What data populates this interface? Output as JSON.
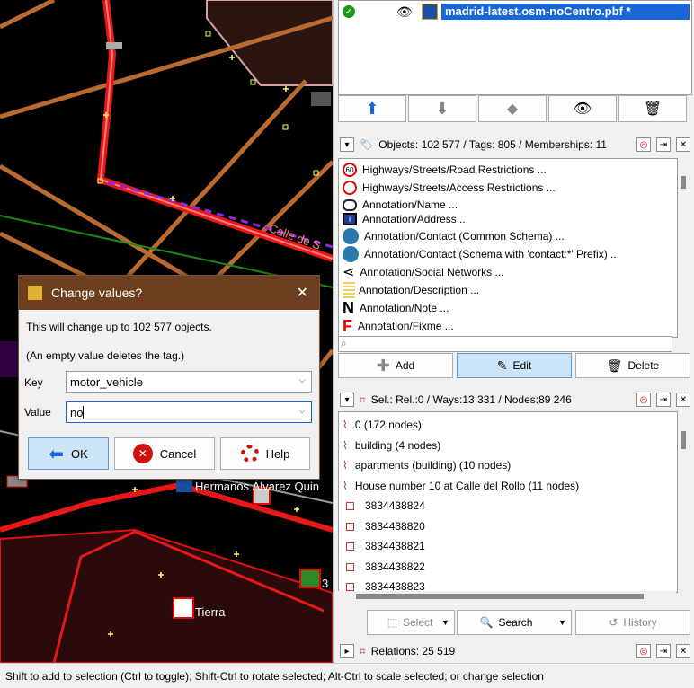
{
  "map": {
    "labels": [
      "Calle de S",
      "Hermanos Álvarez Quin",
      "Tierra",
      "3"
    ]
  },
  "layers": {
    "name": "madrid-latest.osm-noCentro.pbf *"
  },
  "presets": {
    "header": "Objects: 102 577 / Tags: 805 / Memberships: 11",
    "items": [
      "Highways/Streets/Road Restrictions ...",
      "Highways/Streets/Access Restrictions ...",
      "Annotation/Name ...",
      "Annotation/Address ...",
      "Annotation/Contact (Common Schema) ...",
      "Annotation/Contact (Schema with 'contact:*' Prefix) ...",
      "Annotation/Social Networks ...",
      "Annotation/Description ...",
      "Annotation/Note ...",
      "Annotation/Fixme ..."
    ],
    "icon_60": "60",
    "add_label": "Add",
    "edit_label": "Edit",
    "delete_label": "Delete"
  },
  "selection": {
    "header": "Sel.: Rel.:0 / Ways:13 331 / Nodes:89 246",
    "items": [
      "0 (172 nodes)",
      "building (4 nodes)",
      "apartments (building) (10 nodes)",
      "House number 10 at Calle del Rollo (11 nodes)",
      "3834438824",
      "3834438820",
      "3834438821",
      "3834438822",
      "3834438823"
    ],
    "select_label": "Select",
    "search_label": "Search",
    "history_label": "History"
  },
  "relations": {
    "header": "Relations: 25 519"
  },
  "dialog": {
    "title": "Change values?",
    "message": "This will change up to 102 577 objects.",
    "note": "(An empty value deletes the tag.)",
    "key_label": "Key",
    "key_value": "motor_vehicle",
    "value_label": "Value",
    "value_value": "no",
    "ok_label": "OK",
    "cancel_label": "Cancel",
    "help_label": "Help"
  },
  "status": {
    "text": "Shift to add to selection (Ctrl to toggle); Shift-Ctrl to rotate selected; Alt-Ctrl to scale selected; or change selection"
  }
}
